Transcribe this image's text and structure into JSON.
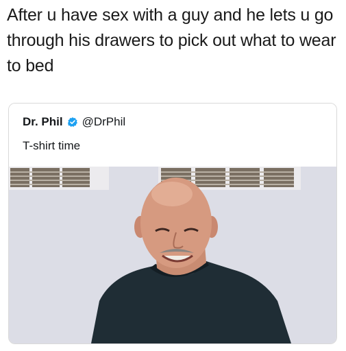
{
  "caption": "After u have sex with a guy and he lets u go through his drawers to pick out what to wear to bed",
  "tweet": {
    "author_name": "Dr. Phil",
    "handle": "@DrPhil",
    "text": "T-shirt time",
    "verified_icon": "verified-badge-icon"
  },
  "colors": {
    "verified": "#1da1f2",
    "wall": "#dcdde6",
    "shirt": "#1f2d35"
  }
}
